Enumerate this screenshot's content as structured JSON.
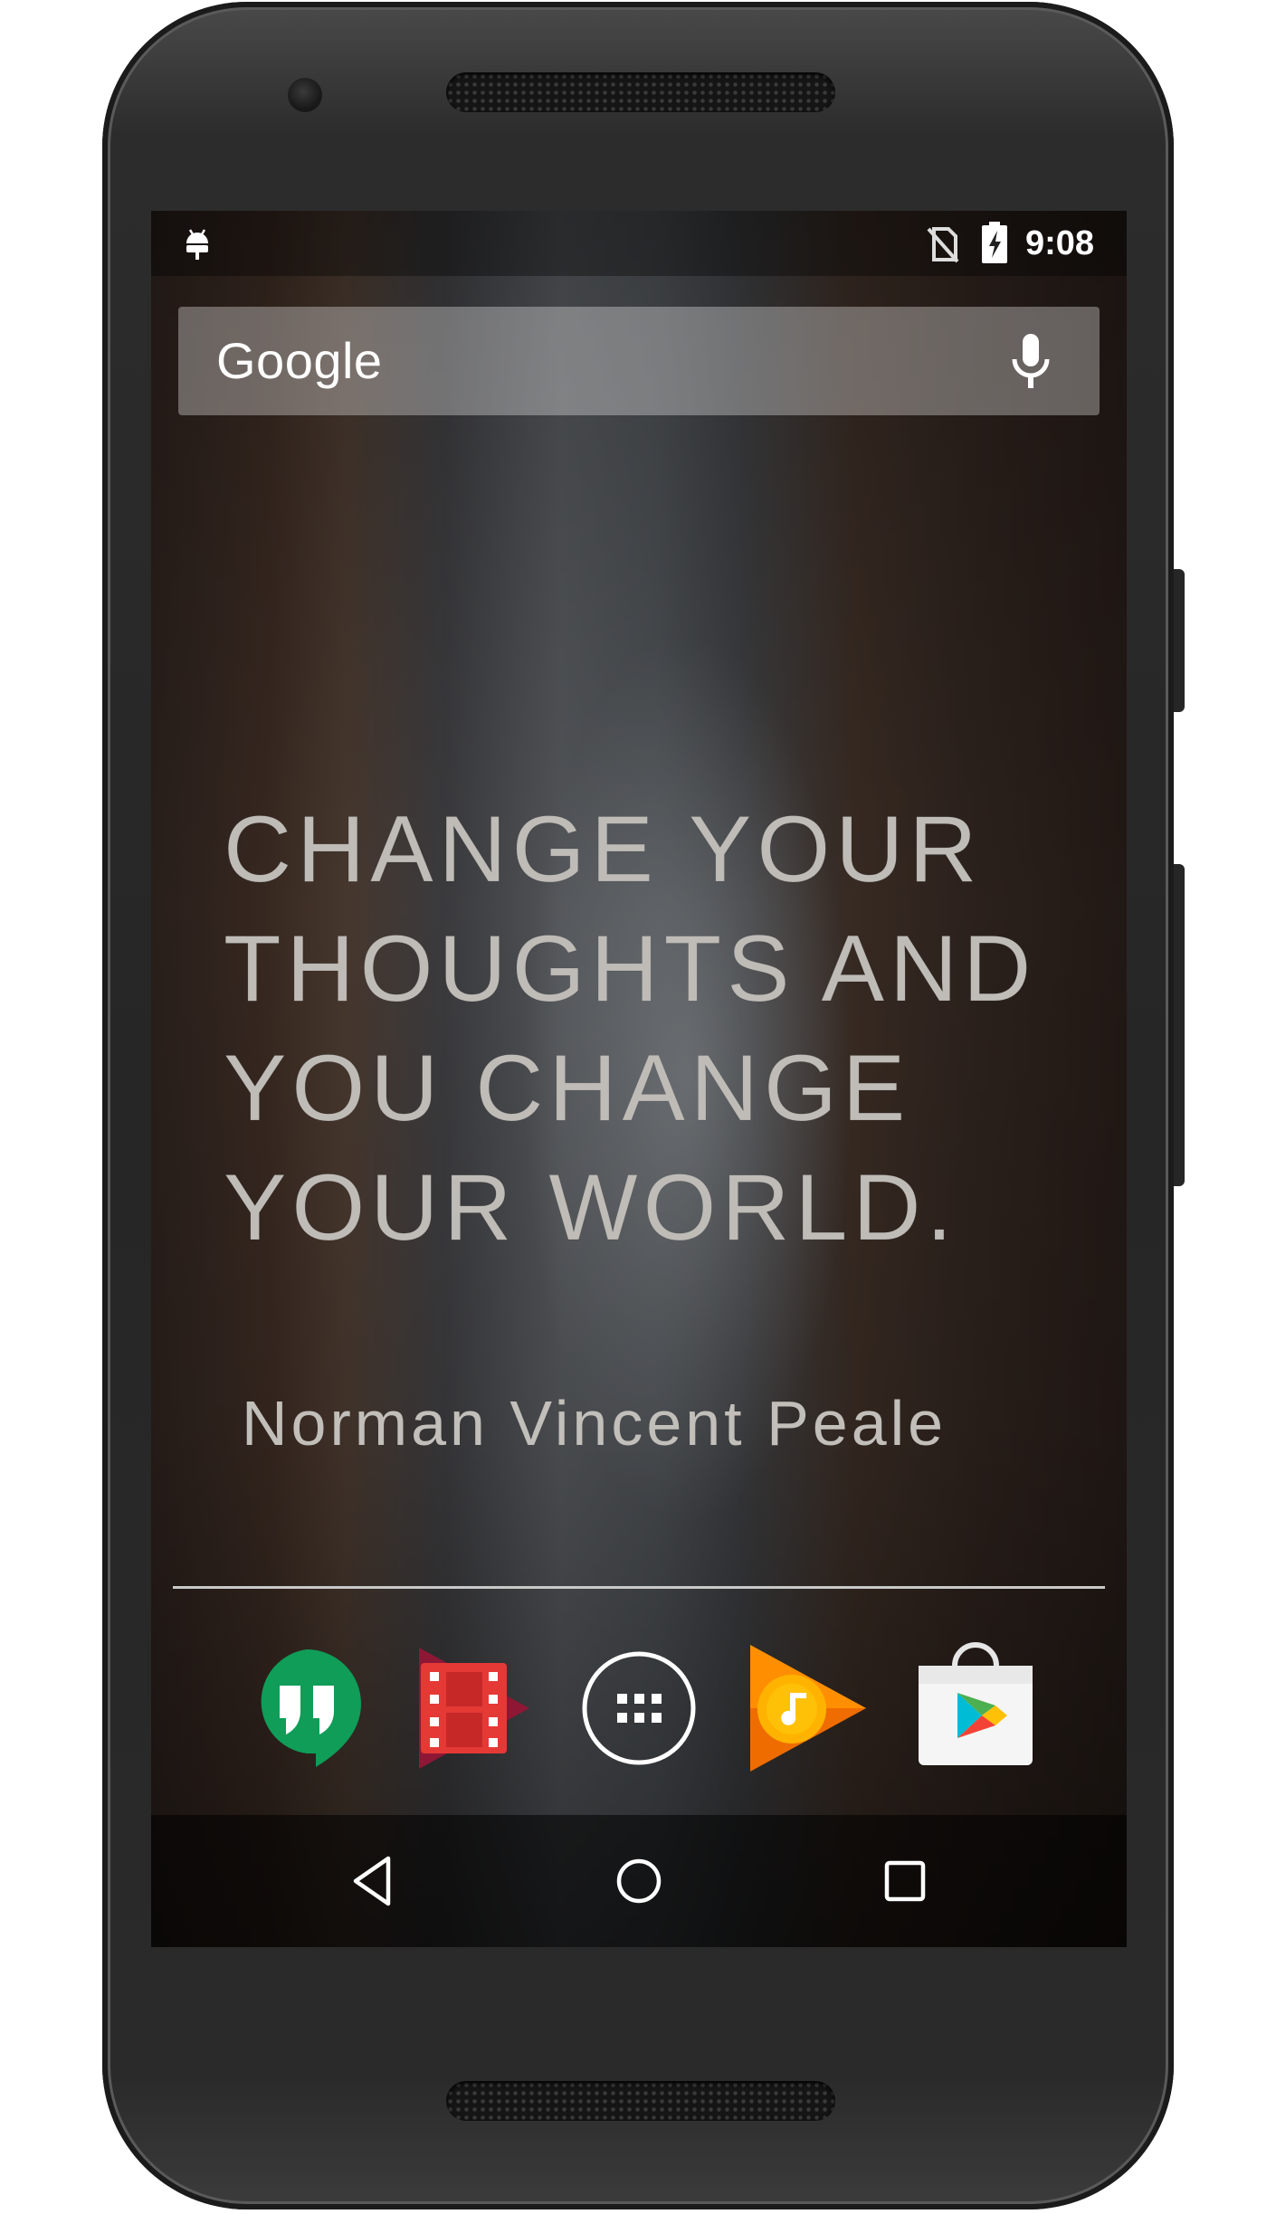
{
  "status_bar": {
    "time": "9:08",
    "icons": [
      "android-debug-icon",
      "no-sim-icon",
      "battery-charging-icon"
    ]
  },
  "search_widget": {
    "logo_text": "Google",
    "mic_icon": "microphone-icon"
  },
  "quote_widget": {
    "quote": "CHANGE YOUR THOUGHTS AND YOU CHANGE YOUR WORLD.",
    "author": "Norman Vincent Peale"
  },
  "dock": {
    "apps": [
      {
        "icon": "hangouts-icon",
        "color": "#0F9D58"
      },
      {
        "icon": "play-movies-icon",
        "color": "#D32F2F"
      },
      {
        "icon": "app-drawer-icon",
        "color": "#FFFFFF"
      },
      {
        "icon": "play-music-icon",
        "color": "#FF8F00"
      },
      {
        "icon": "play-store-icon",
        "color": "#FFFFFF"
      }
    ]
  },
  "nav_bar": {
    "buttons": [
      "back-icon",
      "home-icon",
      "recents-icon"
    ]
  }
}
